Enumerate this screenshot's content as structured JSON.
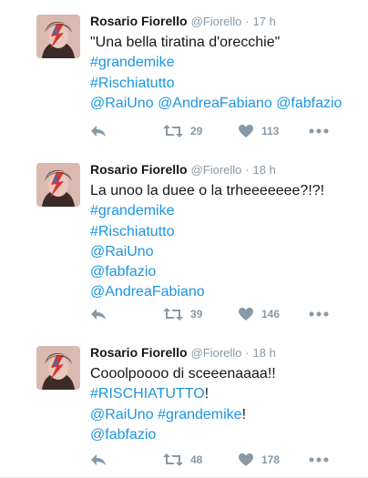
{
  "tweets": [
    {
      "name": "Rosario Fiorello",
      "handle": "@Fiorello",
      "separator": "·",
      "time": "17 h",
      "lines": [
        [
          {
            "text": "\"Una bella tiratina d'orecchie\"",
            "tag": false
          }
        ],
        [
          {
            "text": "#grandemike",
            "tag": true
          }
        ],
        [
          {
            "text": "#Rischiatutto",
            "tag": true
          }
        ],
        [
          {
            "text": "@RaiUno",
            "tag": true
          },
          {
            "text": " ",
            "tag": false
          },
          {
            "text": "@AndreaFabiano",
            "tag": true
          },
          {
            "text": " ",
            "tag": false
          },
          {
            "text": "@fabfazio",
            "tag": true
          }
        ]
      ],
      "retweets": "29",
      "likes": "113"
    },
    {
      "name": "Rosario Fiorello",
      "handle": "@Fiorello",
      "separator": "·",
      "time": "18 h",
      "lines": [
        [
          {
            "text": "La unoo la duee o la trheeeeeee?!?!",
            "tag": false
          }
        ],
        [
          {
            "text": "#grandemike",
            "tag": true
          }
        ],
        [
          {
            "text": "#Rischiatutto",
            "tag": true
          }
        ],
        [
          {
            "text": "@RaiUno",
            "tag": true
          }
        ],
        [
          {
            "text": "@fabfazio",
            "tag": true
          }
        ],
        [
          {
            "text": "@AndreaFabiano",
            "tag": true
          }
        ]
      ],
      "retweets": "39",
      "likes": "146"
    },
    {
      "name": "Rosario Fiorello",
      "handle": "@Fiorello",
      "separator": "·",
      "time": "18 h",
      "lines": [
        [
          {
            "text": "Cooolpoooo di sceeenaaaa!!",
            "tag": false
          }
        ],
        [
          {
            "text": "#RISCHIATUTTO",
            "tag": true
          },
          {
            "text": "!",
            "tag": false
          }
        ],
        [
          {
            "text": "@RaiUno",
            "tag": true
          },
          {
            "text": " ",
            "tag": false
          },
          {
            "text": "#grandemike",
            "tag": true
          },
          {
            "text": "!",
            "tag": false
          }
        ],
        [
          {
            "text": "@fabfazio",
            "tag": true
          }
        ]
      ],
      "retweets": "48",
      "likes": "178"
    }
  ],
  "icons": {
    "reply": "reply-icon",
    "retweet": "retweet-icon",
    "like": "heart-icon",
    "more": "more-dots-icon"
  },
  "colors": {
    "link": "#1b95e0",
    "meta": "#8899a6",
    "text": "#14171a",
    "divider": "#e6ecf0"
  }
}
